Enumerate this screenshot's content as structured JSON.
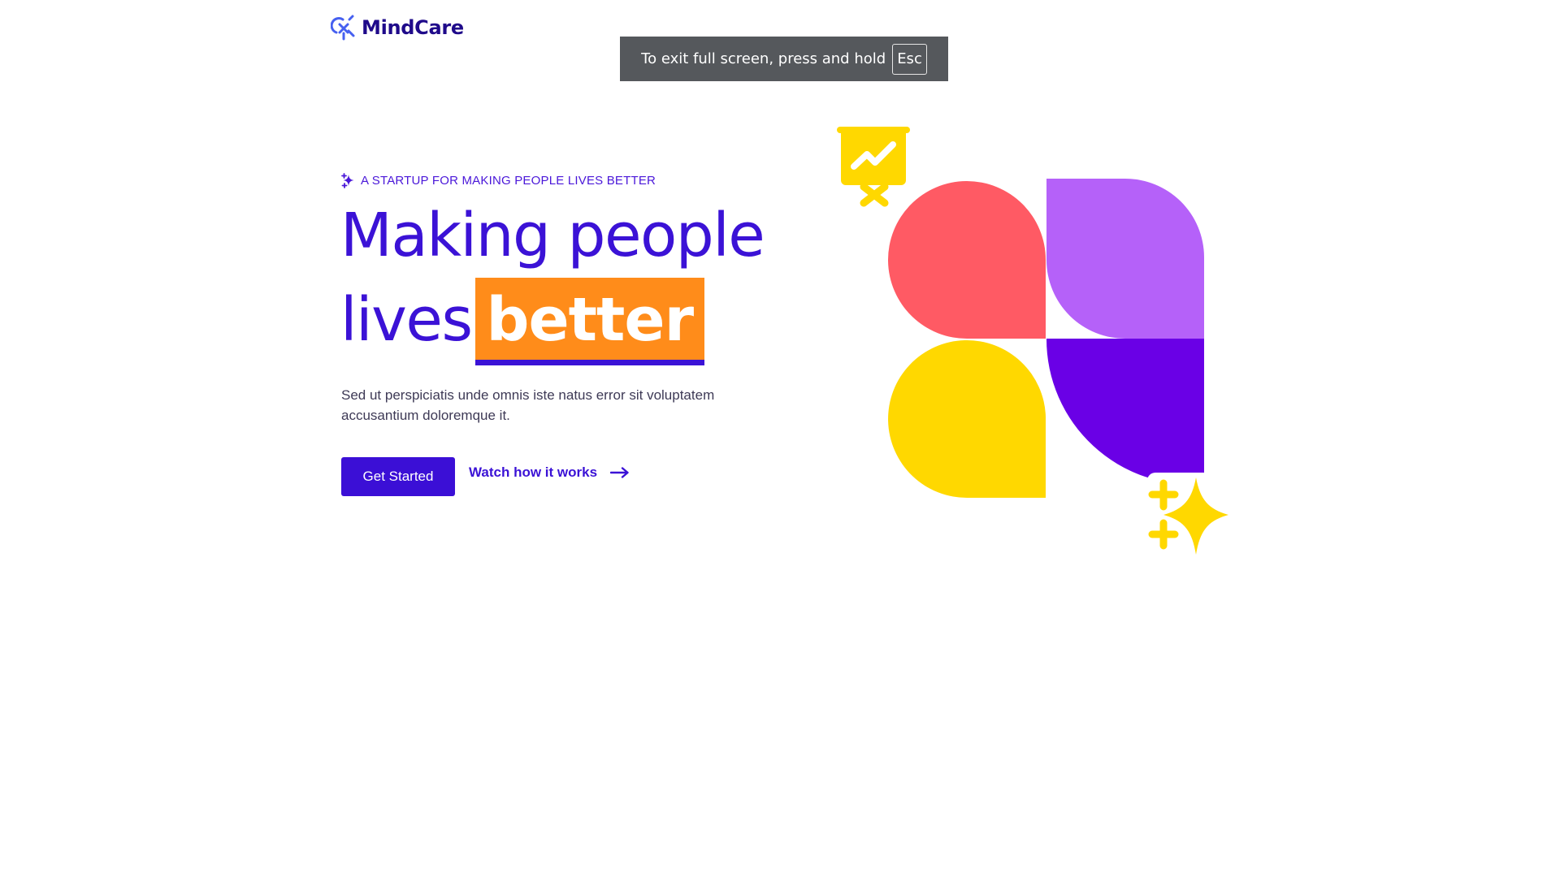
{
  "brand": {
    "name": "MindCare",
    "icon": "mindcare-logo-icon"
  },
  "fullscreen_notice": {
    "text": "To exit full screen, press and hold",
    "key": "Esc"
  },
  "hero": {
    "eyebrow": "A STARTUP FOR MAKING PEOPLE LIVES BETTER",
    "eyebrow_icon": "sparkle-icon",
    "headline_line1": "Making people",
    "headline_line2": "lives",
    "headline_highlight": "better",
    "description": "Sed ut perspiciatis unde omnis iste natus error sit voluptatem accusantium doloremque it.",
    "primary_button": "Get Started",
    "secondary_link": "Watch how it works",
    "secondary_icon": "arrow-right-icon"
  },
  "colors": {
    "brand_dark": "#1f0a8a",
    "primary": "#3b12d6",
    "highlight": "#ff8c1a",
    "petal_red": "#ff5a64",
    "petal_lavender": "#b561f9",
    "petal_yellow": "#ffd800",
    "petal_purple": "#6a00e6",
    "accent_yellow": "#ffd800"
  }
}
